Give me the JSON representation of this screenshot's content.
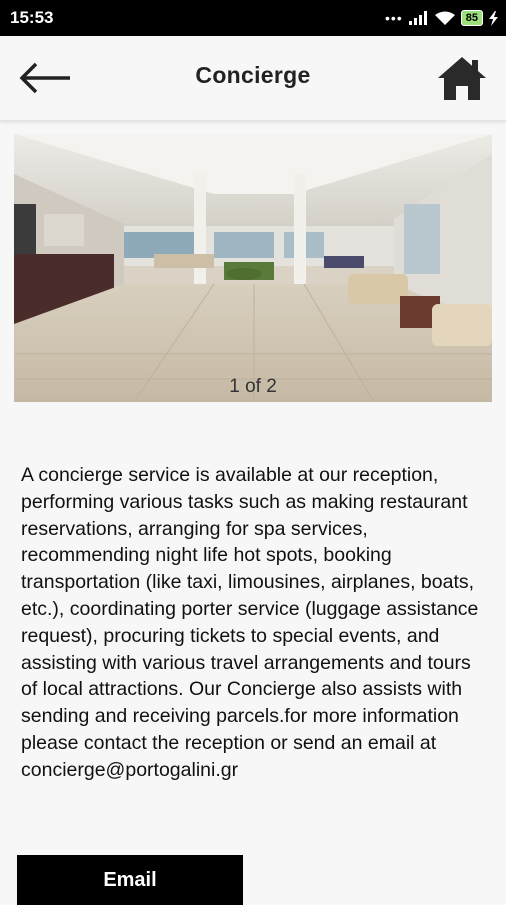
{
  "status_bar": {
    "time": "15:53",
    "battery": "85"
  },
  "header": {
    "title": "Concierge",
    "back_icon": "arrow-left-icon",
    "home_icon": "home-icon"
  },
  "gallery": {
    "counter": "1 of 2",
    "image": "hotel-lobby-photo"
  },
  "content": {
    "description": "A concierge service is available at our reception, performing various tasks such as making restaurant reservations, arranging for spa services, recommending night life hot spots, booking transportation (like taxi, limousines, airplanes, boats, etc.), coordinating porter service (luggage assistance request), procuring tickets to special events, and assisting with various travel arrangements and tours of local attractions. Our Concierge also assists with sending and receiving parcels.for more information please contact the reception or send an email at concierge@portogalini.gr"
  },
  "actions": {
    "email_label": "Email"
  },
  "colors": {
    "background": "#f7f7f7",
    "status_bar": "#000000",
    "button": "#000000",
    "battery": "#9be07a"
  }
}
